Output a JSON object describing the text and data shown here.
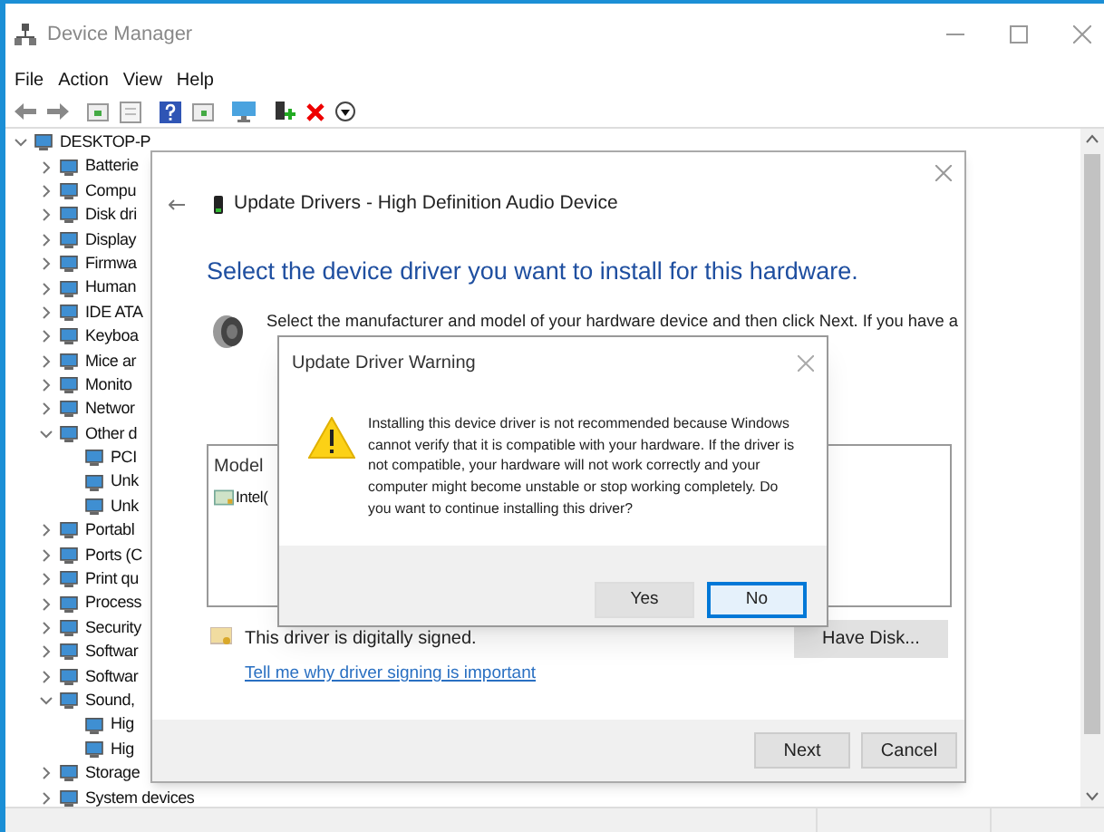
{
  "window": {
    "title": "Device Manager",
    "menu": [
      "File",
      "Action",
      "View",
      "Help"
    ]
  },
  "tree": {
    "label": "DESKTOP-P",
    "expanded": true,
    "children": [
      {
        "label": "Batterie",
        "expanded": false
      },
      {
        "label": "Compu",
        "expanded": false
      },
      {
        "label": "Disk dri",
        "expanded": false
      },
      {
        "label": "Display",
        "expanded": false
      },
      {
        "label": "Firmwa",
        "expanded": false
      },
      {
        "label": "Human",
        "expanded": false
      },
      {
        "label": "IDE ATA",
        "expanded": false
      },
      {
        "label": "Keyboa",
        "expanded": false
      },
      {
        "label": "Mice ar",
        "expanded": false
      },
      {
        "label": "Monito",
        "expanded": false
      },
      {
        "label": "Networ",
        "expanded": false
      },
      {
        "label": "Other d",
        "expanded": true,
        "children": [
          {
            "label": "PCI"
          },
          {
            "label": "Unk"
          },
          {
            "label": "Unk"
          }
        ]
      },
      {
        "label": "Portabl",
        "expanded": false
      },
      {
        "label": "Ports (C",
        "expanded": false
      },
      {
        "label": "Print qu",
        "expanded": false
      },
      {
        "label": "Process",
        "expanded": false
      },
      {
        "label": "Security",
        "expanded": false
      },
      {
        "label": "Softwar",
        "expanded": false
      },
      {
        "label": "Softwar",
        "expanded": false
      },
      {
        "label": "Sound,",
        "expanded": true,
        "children": [
          {
            "label": "Hig"
          },
          {
            "label": "Hig"
          }
        ]
      },
      {
        "label": "Storage",
        "expanded": false
      },
      {
        "label": "System devices",
        "expanded": false
      }
    ]
  },
  "driver_dialog": {
    "title": "Update Drivers - High Definition Audio Device",
    "heading": "Select the device driver you want to install for this hardware.",
    "instruction": "Select the manufacturer and model of your hardware device and then click Next. If you have a",
    "list": {
      "header": "Model",
      "items": [
        {
          "label": "Intel(",
          "selected": false
        }
      ]
    },
    "signature": "This driver is digitally signed.",
    "link": "Tell me why driver signing is important",
    "have_disk": "Have Disk...",
    "buttons": [
      {
        "label": "Next"
      },
      {
        "label": "Cancel"
      }
    ]
  },
  "warning_dialog": {
    "title": "Update Driver Warning",
    "message": "Installing this device driver is not recommended because Windows cannot verify that it is compatible with your hardware.  If the driver is not compatible, your hardware will not work correctly and your computer might become unstable or stop working completely.  Do you want to continue installing this driver?",
    "buttons": [
      {
        "label": "Yes",
        "focused": false
      },
      {
        "label": "No",
        "focused": true
      }
    ]
  }
}
